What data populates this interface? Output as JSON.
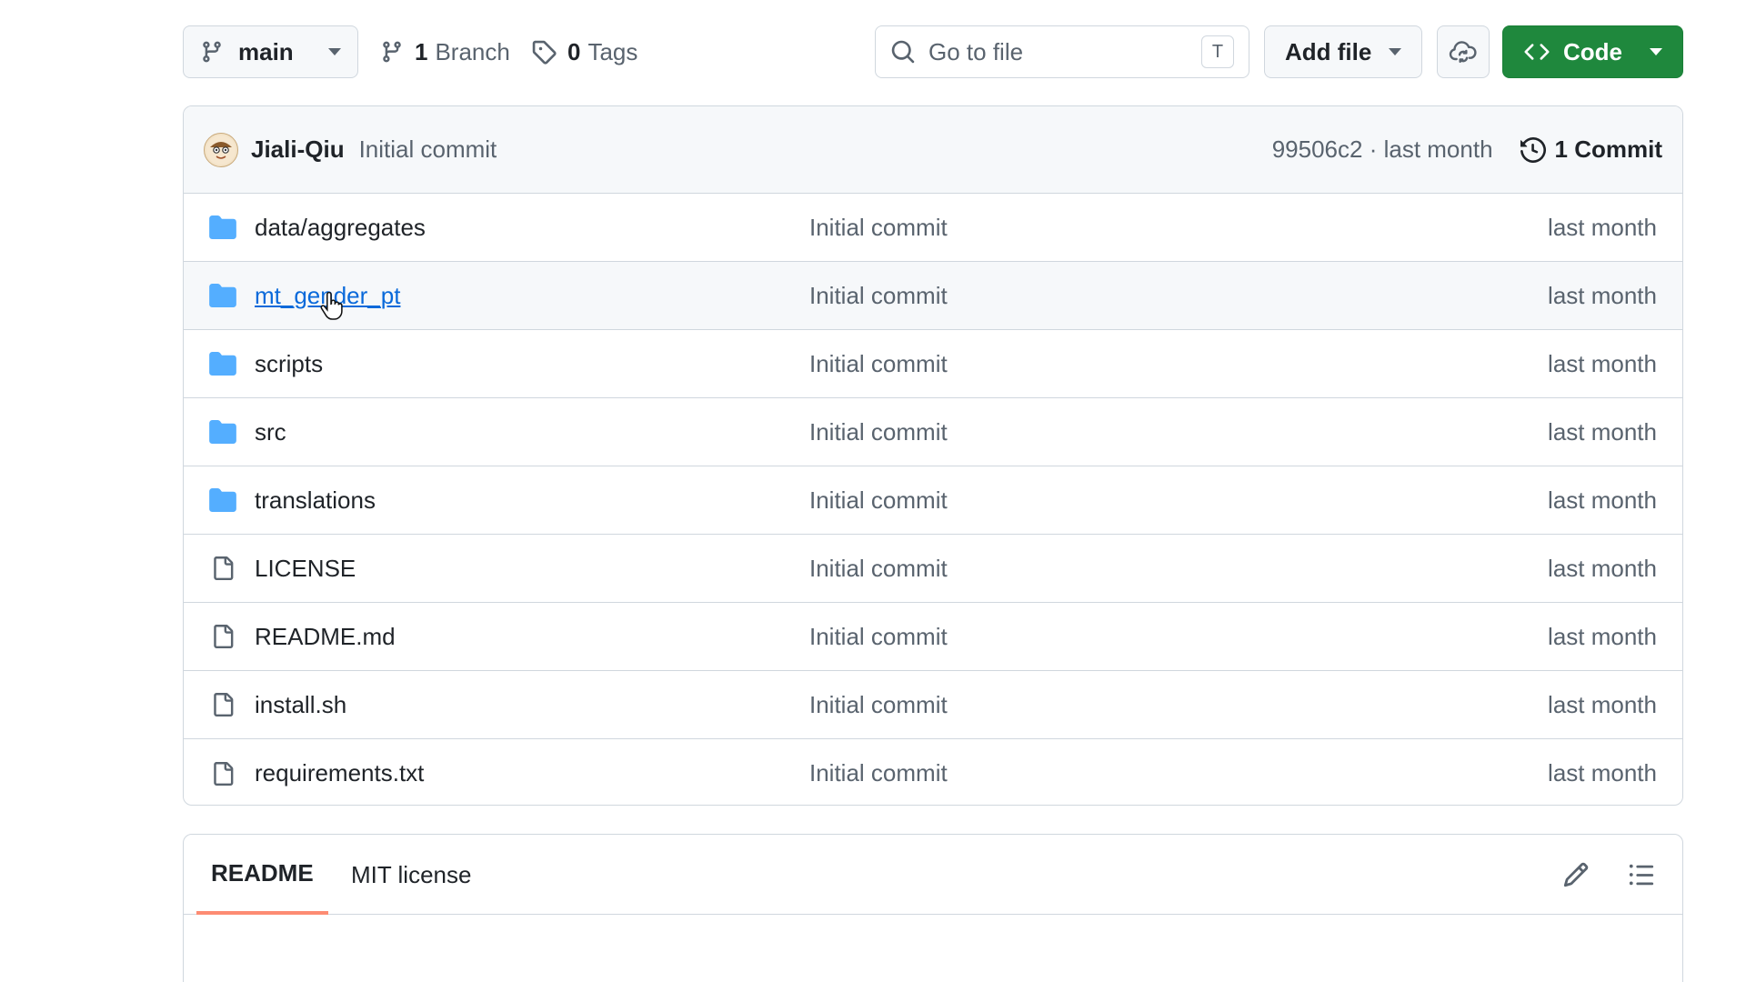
{
  "toolbar": {
    "branch": "main",
    "branches_count": "1",
    "branches_label": "Branch",
    "tags_count": "0",
    "tags_label": "Tags",
    "search_placeholder": "Go to file",
    "search_shortcut": "T",
    "add_file_label": "Add file",
    "code_label": "Code"
  },
  "latest_commit": {
    "author": "Jiali-Qiu",
    "message": "Initial commit",
    "meta": "99506c2 · last month",
    "count_label": "1 Commit"
  },
  "files": [
    {
      "name": "data/aggregates",
      "type": "folder",
      "commit": "Initial commit",
      "date": "last month"
    },
    {
      "name": "mt_gender_pt",
      "type": "folder",
      "commit": "Initial commit",
      "date": "last month"
    },
    {
      "name": "scripts",
      "type": "folder",
      "commit": "Initial commit",
      "date": "last month"
    },
    {
      "name": "src",
      "type": "folder",
      "commit": "Initial commit",
      "date": "last month"
    },
    {
      "name": "translations",
      "type": "folder",
      "commit": "Initial commit",
      "date": "last month"
    },
    {
      "name": "LICENSE",
      "type": "file",
      "commit": "Initial commit",
      "date": "last month"
    },
    {
      "name": "README.md",
      "type": "file",
      "commit": "Initial commit",
      "date": "last month"
    },
    {
      "name": "install.sh",
      "type": "file",
      "commit": "Initial commit",
      "date": "last month"
    },
    {
      "name": "requirements.txt",
      "type": "file",
      "commit": "Initial commit",
      "date": "last month"
    }
  ],
  "readme": {
    "tab_readme": "README",
    "tab_license": "MIT license"
  },
  "colors": {
    "primary_green": "#1f883d",
    "folder_blue": "#54aeff",
    "link_blue": "#0969da",
    "tab_accent": "#fd8c73"
  }
}
